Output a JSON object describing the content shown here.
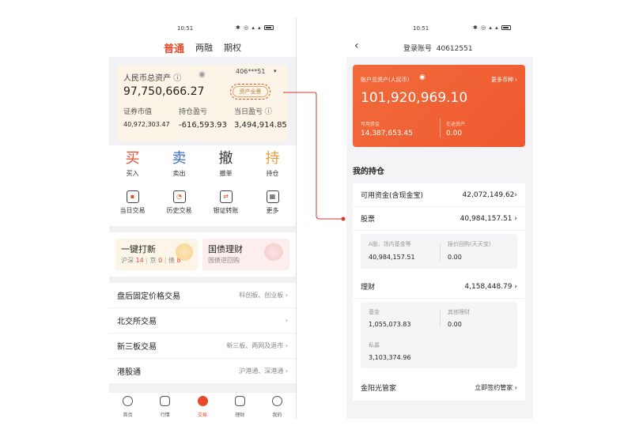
{
  "left": {
    "status_time": "10:51",
    "tabs": [
      "普通",
      "两融",
      "期权"
    ],
    "asset_card": {
      "label": "人民币总资产",
      "help": "ⓘ",
      "eye": "◉",
      "account": "406***51",
      "dropdown": "▾",
      "total": "97,750,666.27",
      "button": "资产全景",
      "cols": [
        {
          "label": "证券市值",
          "value": "40,972,303.47"
        },
        {
          "label": "持仓盈亏",
          "value": "-616,593.93"
        },
        {
          "label": "当日盈亏 ⓘ",
          "value": "3,494,914.85"
        }
      ]
    },
    "actions": [
      {
        "glyph": "买",
        "label": "买入"
      },
      {
        "glyph": "卖",
        "label": "卖出"
      },
      {
        "glyph": "撤",
        "label": "撤单"
      },
      {
        "glyph": "持",
        "label": "持仓"
      }
    ],
    "quick": [
      "当日交易",
      "历史交易",
      "银证转账",
      "更多"
    ],
    "promo": {
      "left": {
        "title": "一键打新",
        "sub_a": "沪深",
        "num_a": "14",
        "sub_b": "京",
        "num_b": "0",
        "sub_c": "债",
        "num_c": "8"
      },
      "right": {
        "title": "国债理财",
        "sub": "国债逆回购"
      }
    },
    "list": [
      {
        "title": "盘后固定价格交易",
        "right": "科创板、创业板"
      },
      {
        "title": "北交所交易",
        "right": ""
      },
      {
        "title": "新三板交易",
        "right": "新三板、两网及退市"
      },
      {
        "title": "港股通",
        "right": "沪港通、深港通"
      }
    ],
    "bottom_nav": [
      "首页",
      "行情",
      "交易",
      "理财",
      "我的"
    ]
  },
  "right": {
    "status_time": "10:51",
    "header": {
      "back": "‹",
      "label": "登录账号",
      "account": "40612551"
    },
    "card": {
      "label": "账户总资产(人民币)",
      "eye": "◉",
      "more": "更多币种 ›",
      "total": "101,920,969.10",
      "k1": "可用资金",
      "v1": "14,387,653.45",
      "k2": "在途资产",
      "v2": "0.00"
    },
    "section_title": "我的持仓",
    "holdings": {
      "cash": {
        "label": "可用资金(含现金宝)",
        "value": "42,072,149.62"
      },
      "stock": {
        "label": "股票",
        "value": "40,984,157.51",
        "k1": "A股、场内基金等",
        "v1": "40,984,157.51",
        "k2": "报价回购(天天宝)",
        "v2": "0.00"
      },
      "wealth": {
        "label": "理财",
        "value": "4,158,448.79",
        "k1": "基金",
        "v1": "1,055,073.83",
        "k2": "其他理财",
        "v2": "0.00",
        "k3": "私募",
        "v3": "3,103,374.96"
      },
      "sunshine": {
        "label": "金阳光管家",
        "value": "立即签约管家"
      }
    }
  },
  "colors": {
    "accent": "#e94b2a",
    "card_orange": "#f0643a",
    "buy": "#e94b2a",
    "sell": "#3b6fc5"
  }
}
